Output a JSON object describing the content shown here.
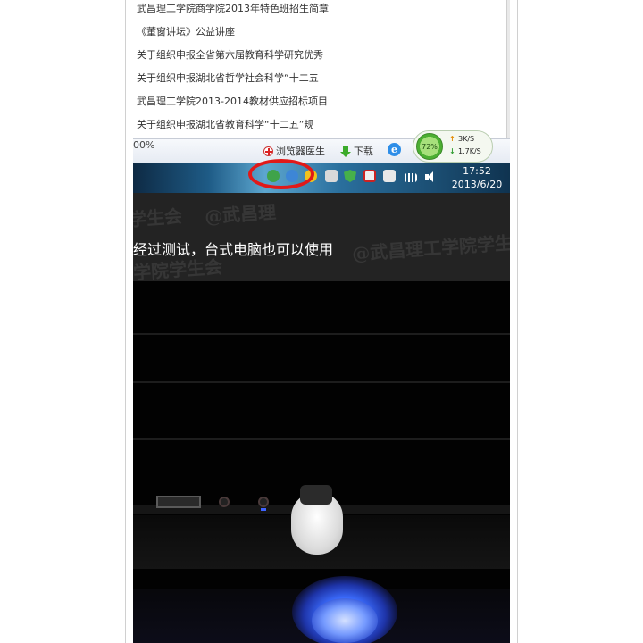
{
  "browser": {
    "links": [
      "武昌理工学院商学院2013年特色班招生简章",
      "《董窗讲坛》公益讲座",
      "关于组织申报全省第六届教育科学研究优秀",
      "关于组织申报湖北省哲学社会科学“十二五",
      "武昌理工学院2013-2014教材供应招标项目",
      "关于组织申报湖北省教育科学“十二五”规"
    ],
    "status_bar": {
      "browser_doctor_label": "浏览器医生",
      "download_label": "下载",
      "zoom_label": "00%"
    },
    "speed_widget": {
      "cpu_percent": "72%",
      "upload_speed": "3K/S",
      "download_speed": "1.7K/S"
    }
  },
  "taskbar": {
    "time": "17:52",
    "date": "2013/6/20",
    "tray_icons": [
      "green-status-icon",
      "blue-search-icon",
      "yellow-icon",
      "people-icon",
      "shield-icon",
      "network-error-icon",
      "device-icon",
      "signal-icon",
      "volume-icon"
    ],
    "highlight_color": "#e11919"
  },
  "caption": {
    "text": "经过测试，台式电脑也可以使用",
    "watermark_1": "学生会",
    "watermark_2": "@武昌理",
    "watermark_3": "@武昌理工学院学生",
    "watermark_4": "学院学生会"
  },
  "photo": {
    "subject": "desktop-pc-front-panel-with-bluetooth-dongle"
  }
}
